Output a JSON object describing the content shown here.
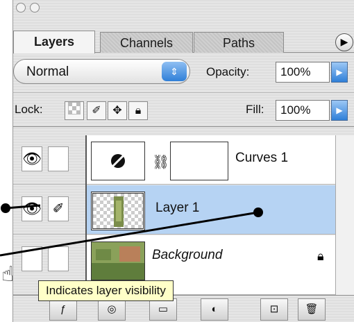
{
  "tabs": [
    {
      "label": "Layers"
    },
    {
      "label": "Channels"
    },
    {
      "label": "Paths"
    }
  ],
  "blend_mode": {
    "value": "Normal"
  },
  "opacity": {
    "label": "Opacity:",
    "value": "100%"
  },
  "lock": {
    "label": "Lock:"
  },
  "fill": {
    "label": "Fill:",
    "value": "100%"
  },
  "layers": [
    {
      "name": "Curves 1"
    },
    {
      "name": "Layer 1",
      "selected": true
    },
    {
      "name": "Background",
      "locked": true
    }
  ],
  "tooltip": {
    "text": "Indicates layer visibility"
  },
  "colors": {
    "selection": "#b6d3f3",
    "accent_blue": "#2f7fd8",
    "tooltip_bg": "#ffffc8"
  }
}
